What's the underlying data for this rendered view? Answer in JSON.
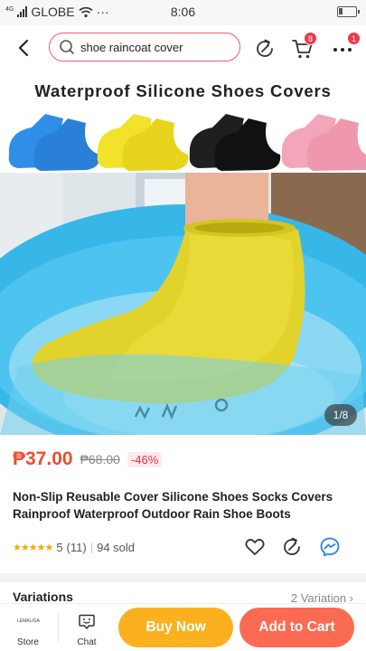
{
  "status_bar": {
    "network": "4G",
    "carrier": "GLOBE",
    "more": "···",
    "time": "8:06"
  },
  "nav": {
    "search_value": "shoe raincoat cover",
    "cart_badge": "8",
    "more_badge": "1"
  },
  "product": {
    "image_title": "Waterproof Silicone Shoes Covers",
    "image_counter": "1/8",
    "price": "₱37.00",
    "original_price": "₱68.00",
    "discount": "-46%",
    "title": "Non-Slip Reusable Cover Silicone Shoes Socks Covers Rainproof Waterproof Outdoor Rain Shoe Boots",
    "stars": "★★★★★",
    "rating": "5",
    "rating_count": "(11)",
    "sold": "94 sold"
  },
  "sections": {
    "variations_label": "Variations",
    "variations_right": "2 Variation ›"
  },
  "bottom_bar": {
    "store_label": "Store",
    "store_logo_text": "LEMALIGA",
    "chat_label": "Chat",
    "buy_now": "Buy Now",
    "add_to_cart": "Add to Cart"
  },
  "colors": {
    "accent": "#ee4d2d",
    "buy_now": "#fbb11f",
    "add_to_cart": "#fb6a52",
    "messenger": "#2b80f6"
  },
  "icons": [
    "back-icon",
    "search-icon",
    "share-icon",
    "cart-icon",
    "more-icon",
    "heart-icon",
    "messenger-icon",
    "store-icon",
    "chat-icon"
  ]
}
